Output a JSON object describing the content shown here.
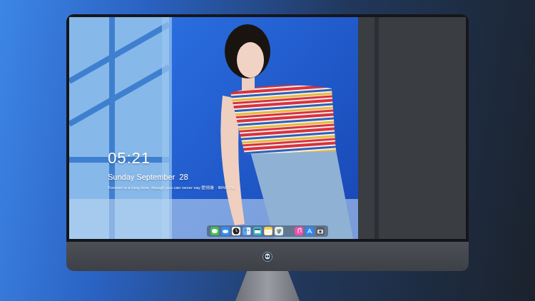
{
  "screen": {
    "clock": "05:21",
    "date": "Sunday September  28",
    "quote": "Forever is a long time, though you can never say 愛情隆 · BINGYN"
  },
  "dock": {
    "items": [
      {
        "kind": "messages"
      },
      {
        "kind": "cloud"
      },
      {
        "kind": "clock"
      },
      {
        "kind": "finder"
      },
      {
        "kind": "video"
      },
      {
        "kind": "notes"
      },
      {
        "kind": "photos"
      },
      {
        "kind": "gap"
      },
      {
        "kind": "music"
      },
      {
        "kind": "store"
      },
      {
        "kind": "camera"
      }
    ]
  }
}
